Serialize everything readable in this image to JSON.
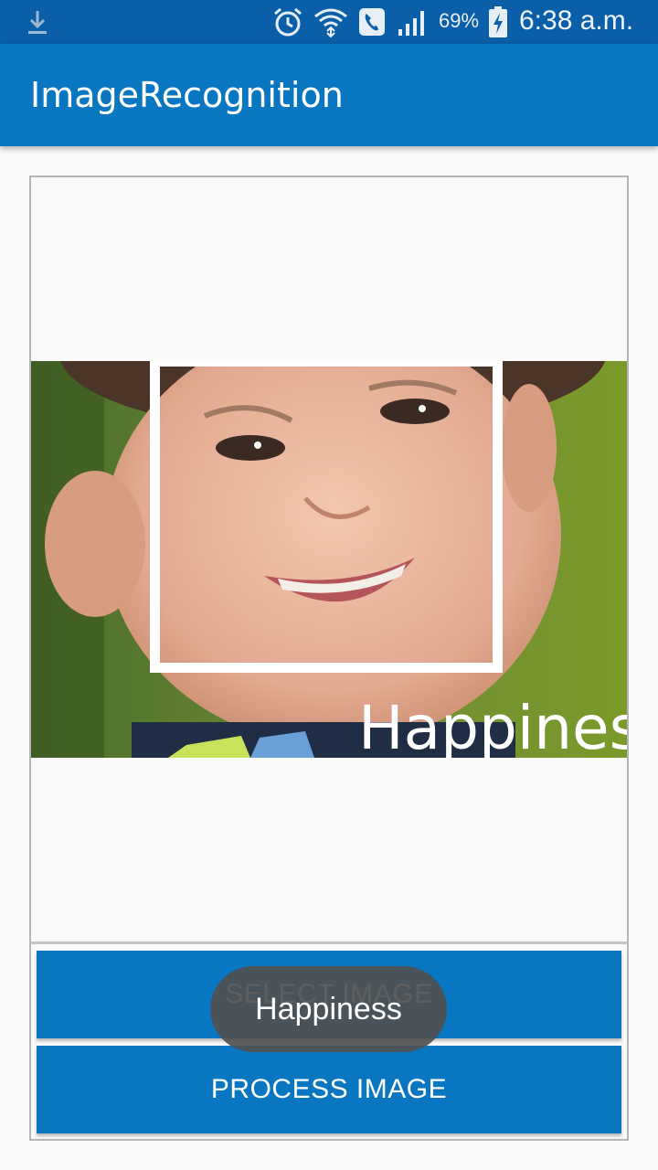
{
  "status_bar": {
    "battery_percent": "69%",
    "time": "6:38 a.m.",
    "icons": [
      "download-icon",
      "alarm-icon",
      "wifi-icon",
      "call-icon",
      "signal-icon",
      "battery-charging-icon"
    ]
  },
  "app_bar": {
    "title": "ImageRecognition"
  },
  "image_panel": {
    "overlay_label": "Happines"
  },
  "buttons": {
    "select_label": "SELECT IMAGE",
    "process_label": "PROCESS IMAGE"
  },
  "toast": {
    "message": "Happiness"
  },
  "colors": {
    "status_bar": "#0a5fa8",
    "app_bar": "#0876c0",
    "button": "#0876c0",
    "background": "#fafafa"
  }
}
